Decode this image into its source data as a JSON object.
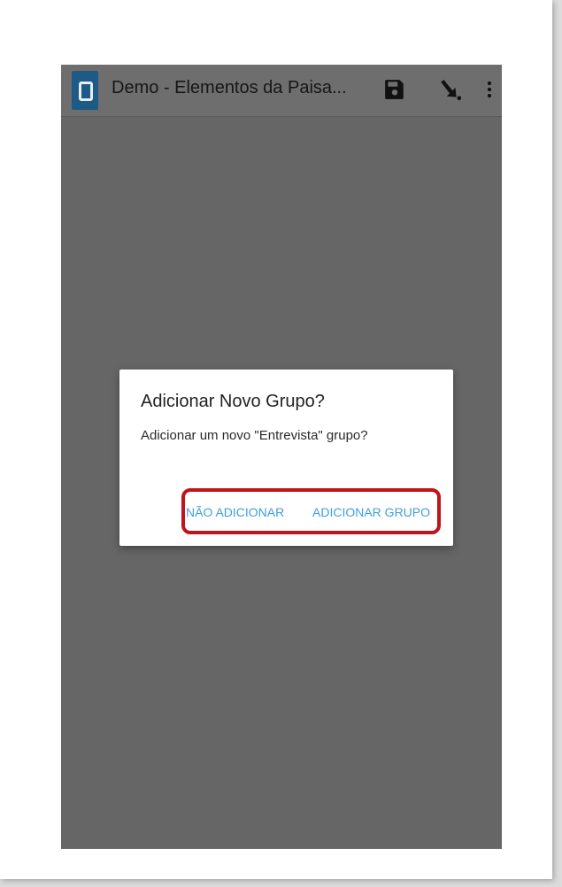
{
  "action_bar": {
    "title": "Demo - Elementos da Paisa...",
    "app_icon": "odk-collect-app-icon",
    "actions": [
      "save-icon",
      "import-arrow-icon",
      "overflow-menu-icon"
    ]
  },
  "dialog": {
    "title": "Adicionar Novo Grupo?",
    "message": "Adicionar um novo \"Entrevista\" grupo?",
    "negative_button": "NÃO ADICIONAR",
    "positive_button": "ADICIONAR GRUPO"
  },
  "colors": {
    "dim_background": "#666666",
    "button_text": "#3d9fe0",
    "highlight_border": "#c0131c",
    "app_icon": "#1e5a86"
  }
}
